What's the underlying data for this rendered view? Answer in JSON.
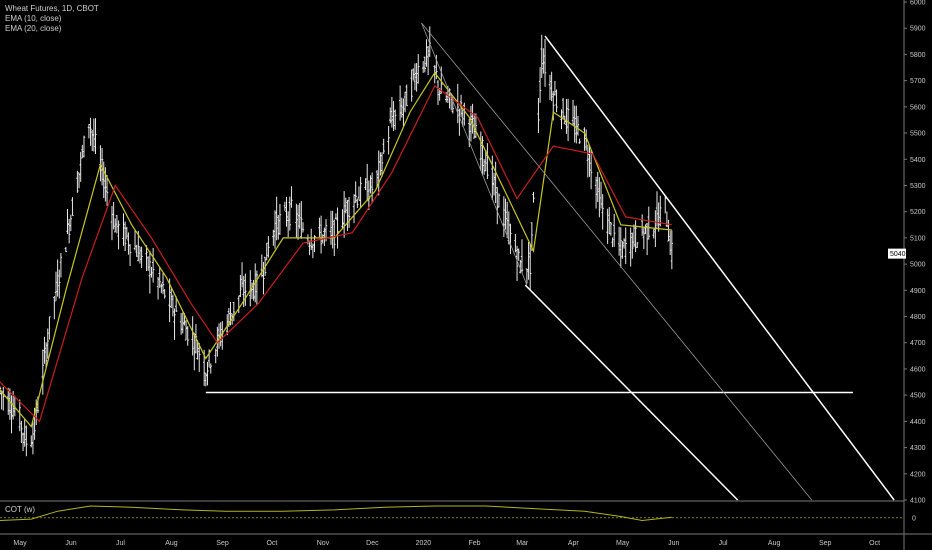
{
  "legend": {
    "symbol": "Wheat Futures, 1D, CBOT",
    "ema10": "EMA (10, close)",
    "ema20": "EMA (20, close)",
    "cot": "COT (w)"
  },
  "colors": {
    "background": "#000000",
    "candles": "#e8e8e8",
    "ema10": "#c8c81e",
    "ema20": "#c81e1e",
    "cot": "#b4b41e",
    "lines": "#ffffff",
    "grid_axis": "#777777"
  },
  "chart_data": {
    "type": "line",
    "title": "Wheat Futures, 1D, CBOT",
    "y_axis": {
      "ticks": [
        6000,
        5900,
        5800,
        5700,
        5600,
        5500,
        5400,
        5300,
        5200,
        5100,
        5000,
        4900,
        4800,
        4700,
        4600,
        4500,
        4400,
        4300,
        4200,
        4100
      ],
      "range": [
        4100,
        6000
      ],
      "last_price_label": "5040"
    },
    "x_axis": {
      "labels": [
        "May",
        "Jun",
        "Jul",
        "Aug",
        "Sep",
        "Oct",
        "Nov",
        "Dec",
        "2020",
        "Feb",
        "Mar",
        "Apr",
        "May",
        "Jun",
        "Jul",
        "Aug",
        "Sep",
        "Oct"
      ],
      "start": "2019-05-01",
      "end": "2020-10-31"
    },
    "price_path": [
      [
        "2019-05-01",
        4520
      ],
      [
        "2019-05-12",
        4430
      ],
      [
        "2019-05-18",
        4300
      ],
      [
        "2019-05-22",
        4380
      ],
      [
        "2019-06-01",
        4800
      ],
      [
        "2019-06-15",
        5250
      ],
      [
        "2019-06-24",
        5550
      ],
      [
        "2019-07-01",
        5380
      ],
      [
        "2019-07-10",
        5150
      ],
      [
        "2019-07-20",
        5080
      ],
      [
        "2019-08-01",
        4980
      ],
      [
        "2019-08-15",
        4820
      ],
      [
        "2019-08-28",
        4700
      ],
      [
        "2019-09-03",
        4600
      ],
      [
        "2019-09-10",
        4700
      ],
      [
        "2019-09-25",
        4900
      ],
      [
        "2019-10-05",
        4920
      ],
      [
        "2019-10-15",
        5150
      ],
      [
        "2019-10-25",
        5200
      ],
      [
        "2019-11-05",
        5100
      ],
      [
        "2019-11-20",
        5120
      ],
      [
        "2019-12-01",
        5250
      ],
      [
        "2019-12-15",
        5300
      ],
      [
        "2019-12-25",
        5550
      ],
      [
        "2020-01-01",
        5600
      ],
      [
        "2020-01-10",
        5750
      ],
      [
        "2020-01-17",
        5800
      ],
      [
        "2020-01-24",
        5650
      ],
      [
        "2020-02-03",
        5600
      ],
      [
        "2020-02-10",
        5550
      ],
      [
        "2020-02-20",
        5400
      ],
      [
        "2020-03-01",
        5200
      ],
      [
        "2020-03-12",
        5000
      ],
      [
        "2020-03-18",
        5000
      ],
      [
        "2020-03-25",
        5800
      ],
      [
        "2020-04-01",
        5650
      ],
      [
        "2020-04-10",
        5550
      ],
      [
        "2020-04-20",
        5480
      ],
      [
        "2020-05-01",
        5200
      ],
      [
        "2020-05-12",
        5050
      ],
      [
        "2020-05-20",
        5100
      ],
      [
        "2020-06-01",
        5150
      ],
      [
        "2020-06-08",
        5220
      ],
      [
        "2020-06-12",
        5040
      ]
    ],
    "series": [
      {
        "name": "EMA (10, close)",
        "points": [
          [
            "2019-05-01",
            4520
          ],
          [
            "2019-05-20",
            4380
          ],
          [
            "2019-06-10",
            4900
          ],
          [
            "2019-07-01",
            5380
          ],
          [
            "2019-07-20",
            5150
          ],
          [
            "2019-08-10",
            4950
          ],
          [
            "2019-09-03",
            4640
          ],
          [
            "2019-09-25",
            4850
          ],
          [
            "2019-10-20",
            5100
          ],
          [
            "2019-11-20",
            5100
          ],
          [
            "2019-12-15",
            5280
          ],
          [
            "2020-01-05",
            5580
          ],
          [
            "2020-01-20",
            5730
          ],
          [
            "2020-02-10",
            5560
          ],
          [
            "2020-03-01",
            5300
          ],
          [
            "2020-03-20",
            5050
          ],
          [
            "2020-04-01",
            5580
          ],
          [
            "2020-04-20",
            5500
          ],
          [
            "2020-05-12",
            5150
          ],
          [
            "2020-06-12",
            5130
          ]
        ]
      },
      {
        "name": "EMA (20, close)",
        "points": [
          [
            "2019-05-01",
            4550
          ],
          [
            "2019-05-25",
            4400
          ],
          [
            "2019-06-20",
            4950
          ],
          [
            "2019-07-10",
            5300
          ],
          [
            "2019-08-01",
            5100
          ],
          [
            "2019-08-25",
            4850
          ],
          [
            "2019-09-10",
            4700
          ],
          [
            "2019-10-05",
            4850
          ],
          [
            "2019-11-01",
            5080
          ],
          [
            "2019-12-01",
            5120
          ],
          [
            "2019-12-25",
            5350
          ],
          [
            "2020-01-20",
            5680
          ],
          [
            "2020-02-15",
            5560
          ],
          [
            "2020-03-10",
            5250
          ],
          [
            "2020-04-01",
            5450
          ],
          [
            "2020-04-25",
            5420
          ],
          [
            "2020-05-15",
            5180
          ],
          [
            "2020-06-12",
            5150
          ]
        ]
      }
    ],
    "drawings": {
      "horizontal_line": {
        "from": "2019-09-03",
        "to": "2020-09-30",
        "price": 4510
      },
      "channel_1": [
        {
          "from": [
            "2020-01-12",
            5920
          ],
          "to": [
            "2020-09-05",
            4100
          ]
        },
        {
          "from": [
            "2020-01-12",
            5920
          ],
          "to": [
            "2020-03-16",
            4920
          ]
        }
      ],
      "channel_2": [
        {
          "from": [
            "2020-03-27",
            5870
          ],
          "to": [
            "2020-10-25",
            4100
          ]
        },
        {
          "from": [
            "2020-03-15",
            4920
          ],
          "to": [
            "2020-07-22",
            4100
          ]
        }
      ]
    },
    "cot": {
      "name": "COT (w)",
      "zero_label": "0",
      "points": [
        [
          "2019-05-01",
          -0.2
        ],
        [
          "2019-05-20",
          -0.1
        ],
        [
          "2019-06-05",
          0.5
        ],
        [
          "2019-06-25",
          0.9
        ],
        [
          "2019-07-20",
          0.8
        ],
        [
          "2019-08-20",
          0.6
        ],
        [
          "2019-09-15",
          0.5
        ],
        [
          "2019-10-20",
          0.5
        ],
        [
          "2019-11-20",
          0.6
        ],
        [
          "2019-12-20",
          0.8
        ],
        [
          "2020-01-20",
          0.9
        ],
        [
          "2020-02-20",
          0.9
        ],
        [
          "2020-03-20",
          0.7
        ],
        [
          "2020-04-20",
          0.5
        ],
        [
          "2020-05-12",
          0.1
        ],
        [
          "2020-05-25",
          -0.2
        ],
        [
          "2020-06-12",
          0.05
        ]
      ]
    }
  }
}
